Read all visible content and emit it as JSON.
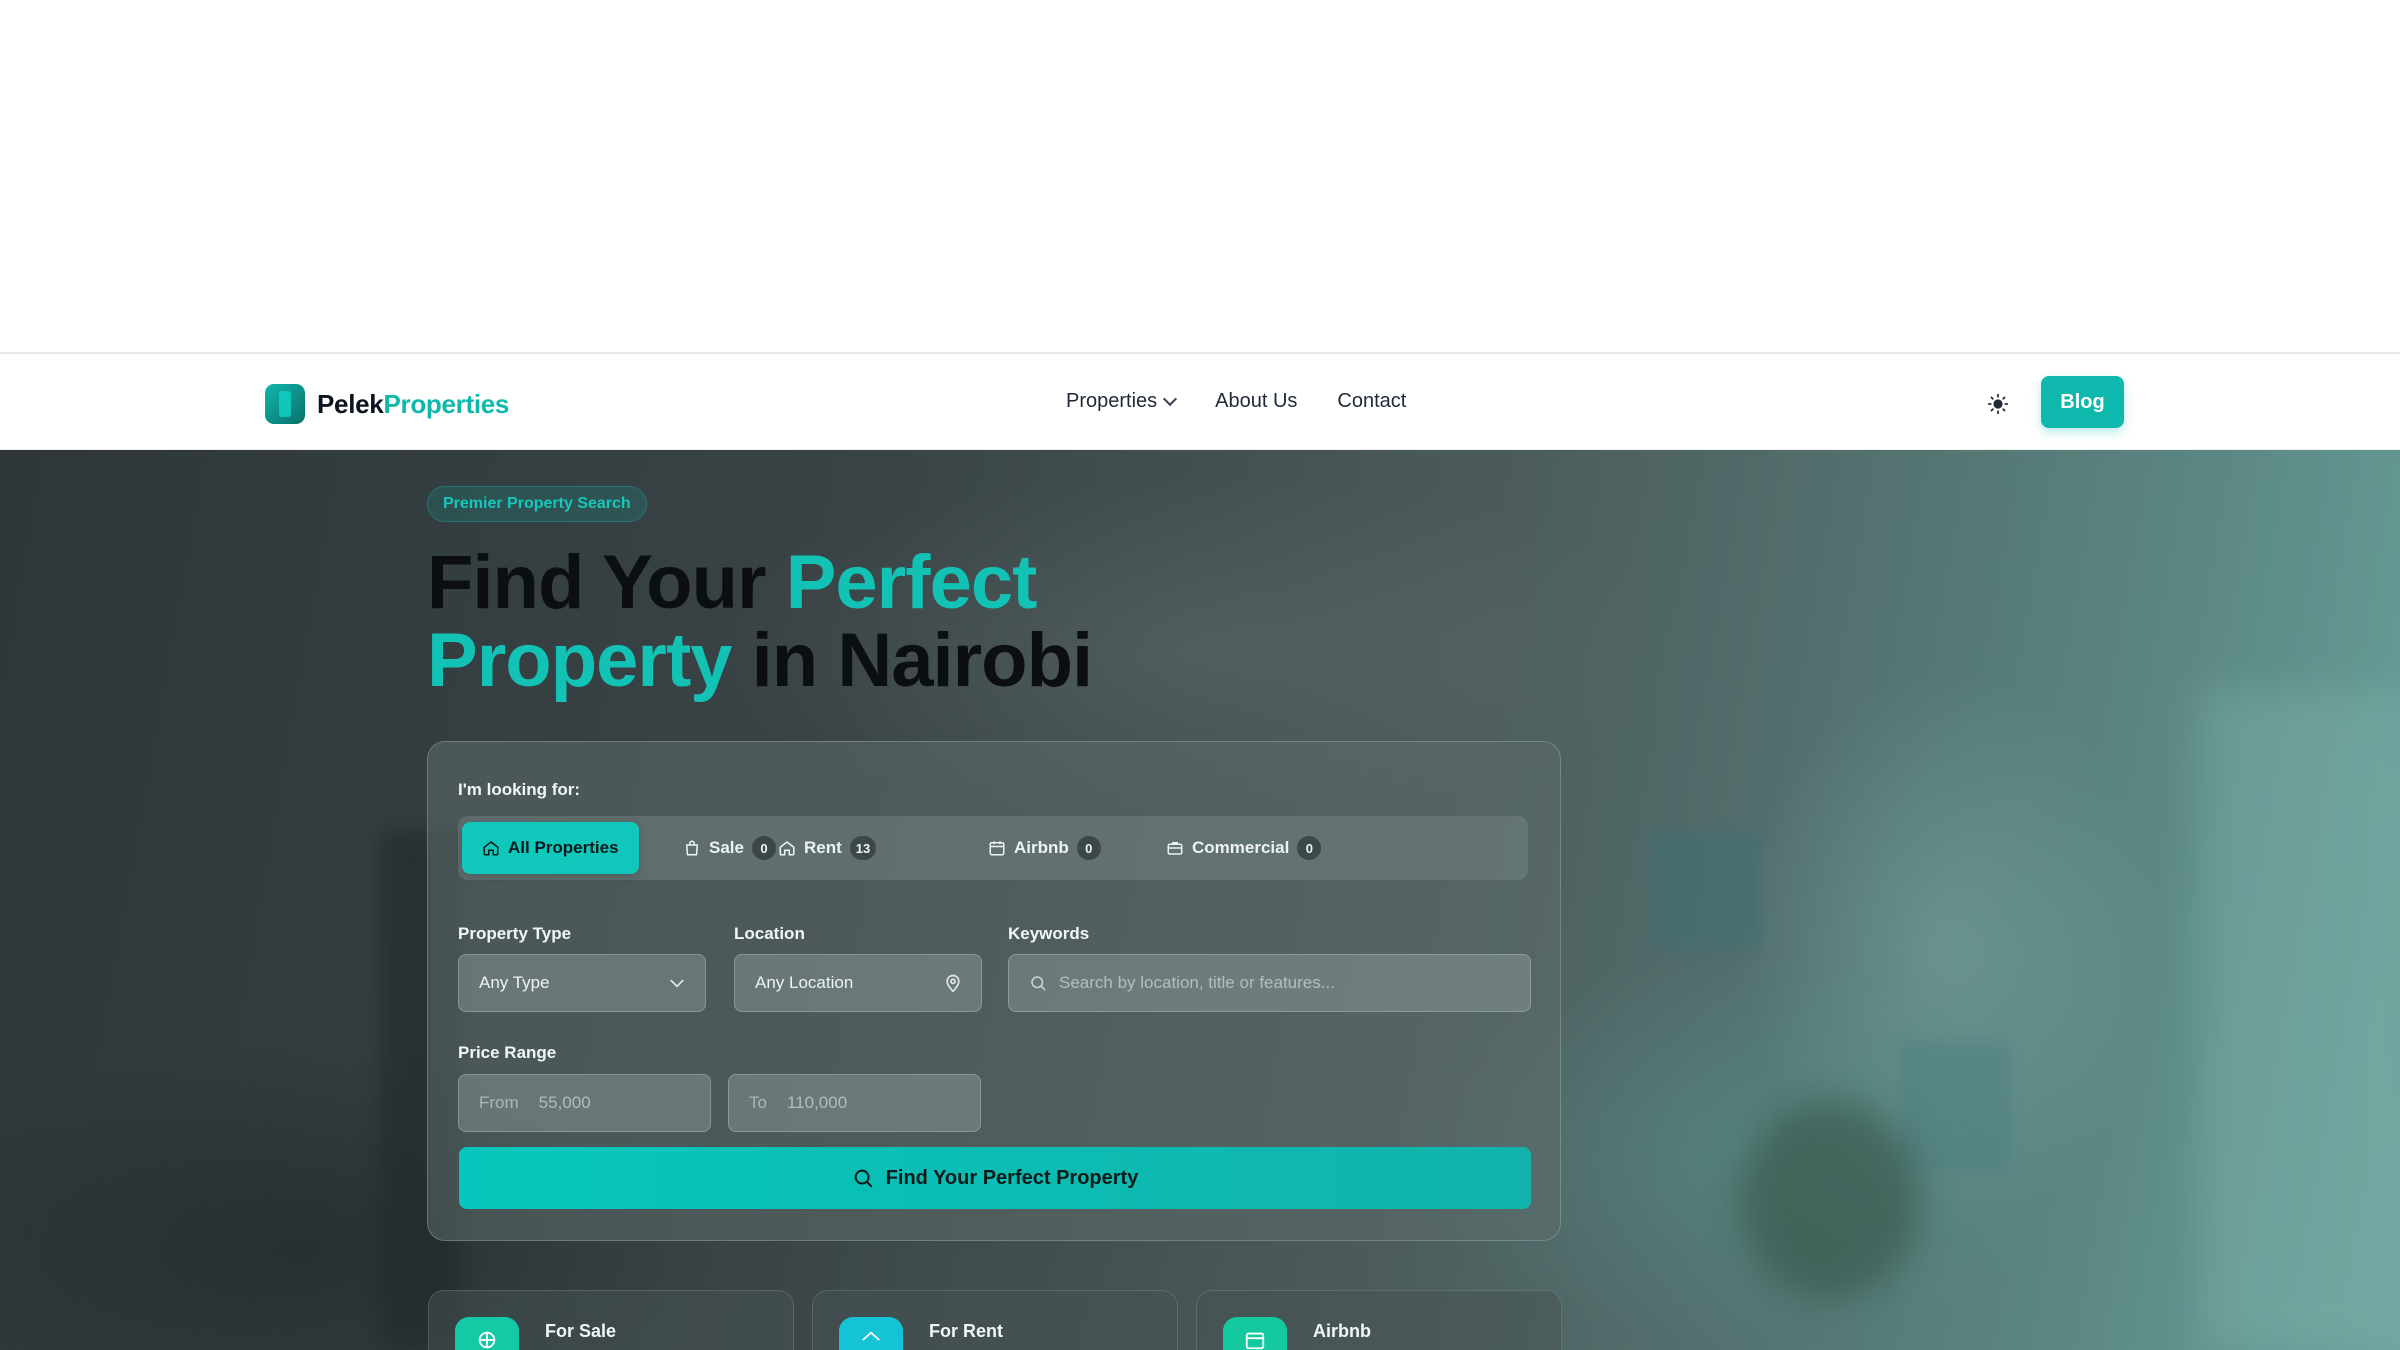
{
  "brand": {
    "name_part1": "Pelek",
    "name_part2": "Properties"
  },
  "nav": {
    "links": [
      {
        "label": "Properties",
        "has_dropdown": true
      },
      {
        "label": "About Us"
      },
      {
        "label": "Contact"
      }
    ],
    "theme_icon": "sun-icon",
    "blog_label": "Blog"
  },
  "hero": {
    "badge": "Premier Property Search",
    "headline_1": "Find Your ",
    "headline_accent_1": "Perfect",
    "headline_accent_2": "Property",
    "headline_2": " in Nairobi"
  },
  "search": {
    "looking_for_label": "I'm looking for:",
    "tabs": [
      {
        "label": "All Properties",
        "icon": "home-icon",
        "active": true
      },
      {
        "label": "Sale",
        "icon": "bag-icon",
        "count": "0"
      },
      {
        "label": "Rent",
        "icon": "home-icon",
        "count": "13"
      },
      {
        "label": "Airbnb",
        "icon": "calendar-icon",
        "count": "0"
      },
      {
        "label": "Commercial",
        "icon": "briefcase-icon",
        "count": "0"
      }
    ],
    "property_type_label": "Property Type",
    "property_type_value": "Any Type",
    "location_label": "Location",
    "location_value": "Any Location",
    "keywords_label": "Keywords",
    "keywords_placeholder": "Search by location, title or features...",
    "price_range_label": "Price Range",
    "price_from_label": "From",
    "price_from_value": "55,000",
    "price_to_label": "To",
    "price_to_value": "110,000",
    "submit_label": "Find Your Perfect Property"
  },
  "categories": [
    {
      "title": "For Sale",
      "icon": "tag-icon",
      "color": "#13c9a6"
    },
    {
      "title": "For Rent",
      "icon": "home-icon",
      "color": "#15c3d6"
    },
    {
      "title": "Airbnb",
      "icon": "calendar-icon",
      "color": "#15c99f"
    }
  ],
  "colors": {
    "accent": "#0fb8ad",
    "headline_dark": "#0b0f14"
  }
}
